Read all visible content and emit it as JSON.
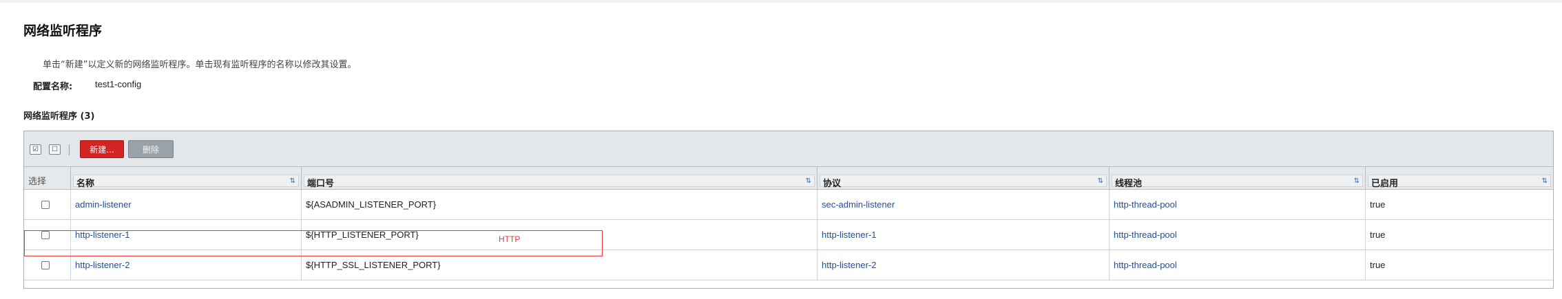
{
  "page": {
    "title": "网络监听程序",
    "help_text": "单击“新建”以定义新的网络监听程序。单击现有监听程序的名称以修改其设置。",
    "config_label": "配置名称:",
    "config_value": "test1-config"
  },
  "table": {
    "title": "网络监听程序 (3)",
    "toolbar": {
      "select_all_icon": "select-all-icon",
      "deselect_all_icon": "deselect-all-icon",
      "new_label": "新建...",
      "delete_label": "删除"
    },
    "columns": {
      "select": "选择",
      "name": "名称",
      "port": "端口号",
      "protocol": "协议",
      "thread_pool": "线程池",
      "enabled": "已启用",
      "sort_icon": "sort-icon"
    },
    "rows": [
      {
        "name": "admin-listener",
        "port": "${ASADMIN_LISTENER_PORT}",
        "protocol": "sec-admin-listener",
        "thread_pool": "http-thread-pool",
        "enabled": "true"
      },
      {
        "name": "http-listener-1",
        "port": "${HTTP_LISTENER_PORT}",
        "protocol": "http-listener-1",
        "thread_pool": "http-thread-pool",
        "enabled": "true"
      },
      {
        "name": "http-listener-2",
        "port": "${HTTP_SSL_LISTENER_PORT}",
        "protocol": "http-listener-2",
        "thread_pool": "http-thread-pool",
        "enabled": "true"
      }
    ]
  },
  "annotation": {
    "label": "HTTP",
    "color": "#e53935"
  },
  "colors": {
    "new_button": "#d42323",
    "delete_button": "#98a2a8",
    "link": "#1f4f99",
    "header_bg": "#e6e9ec"
  }
}
